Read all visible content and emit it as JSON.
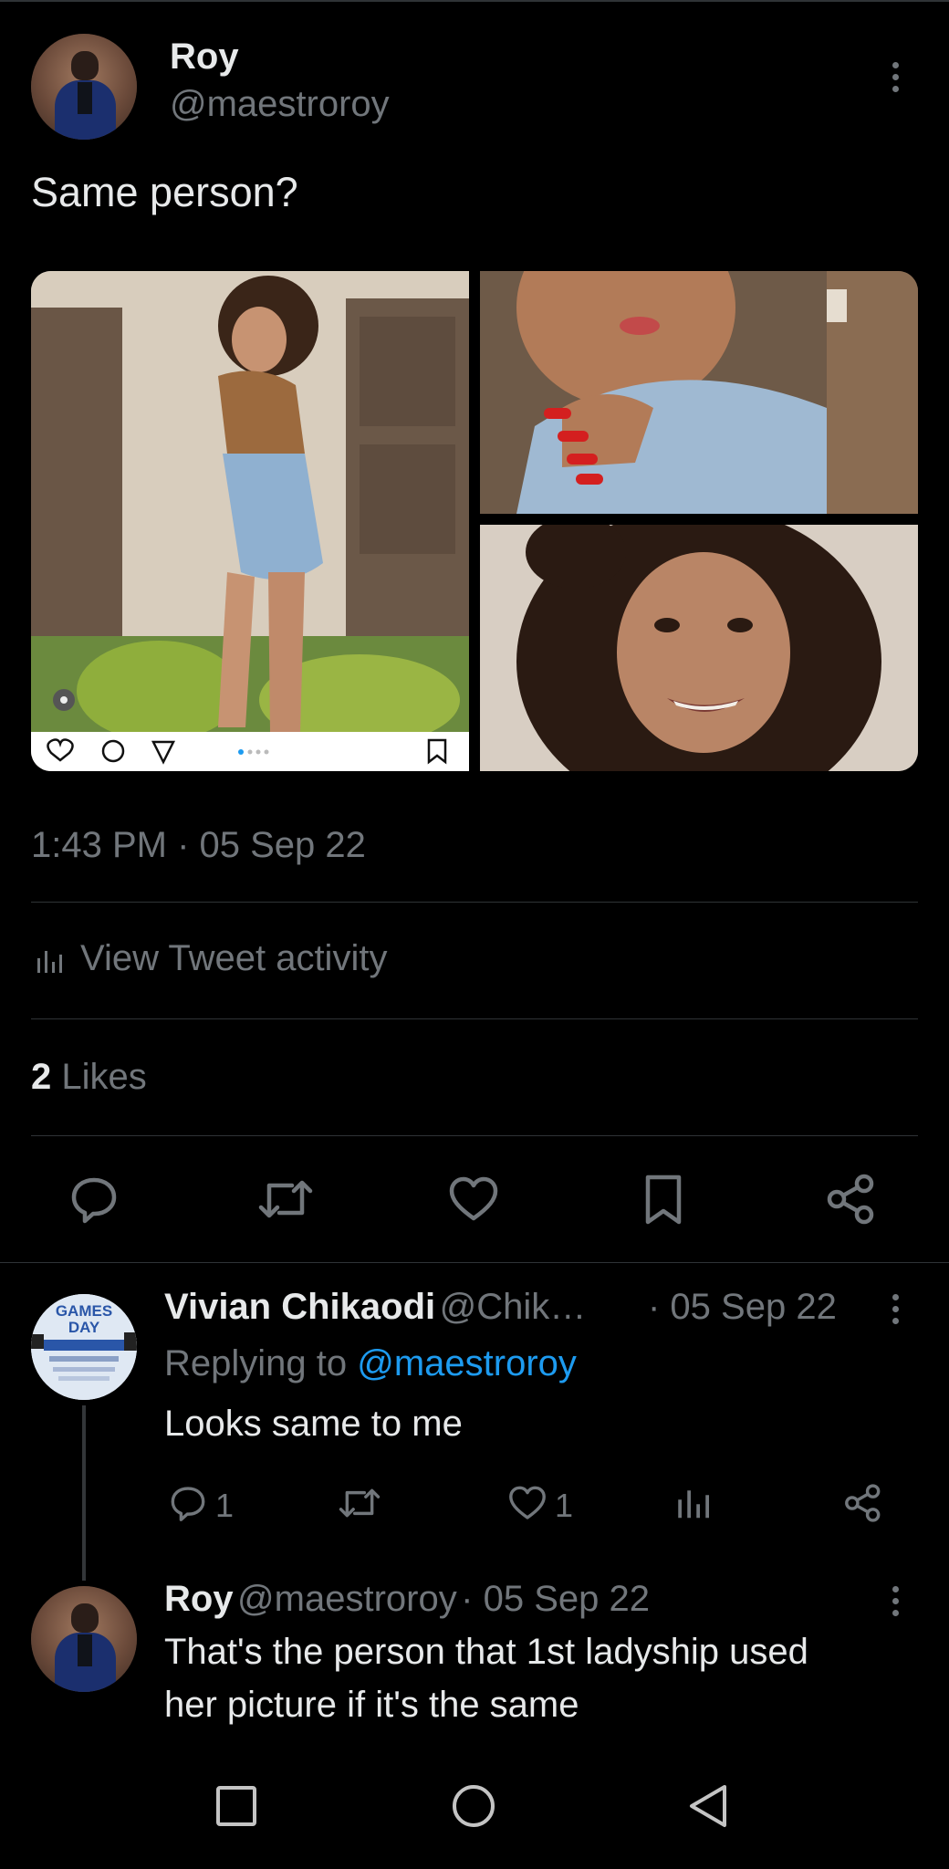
{
  "tweet": {
    "author_name": "Roy",
    "author_handle": "@maestroroy",
    "text": "Same person?",
    "timestamp": "1:43 PM · 05 Sep 22",
    "activity_label": "View Tweet activity",
    "likes_count": "2",
    "likes_label": "Likes"
  },
  "replies": [
    {
      "name": "Vivian Chikaodi",
      "handle": "@Chik…",
      "date": "· 05 Sep 22",
      "replying_prefix": "Replying to",
      "replying_to": "@maestroroy",
      "text": "Looks same to me",
      "reply_count": "1",
      "like_count": "1",
      "avatar_text": "GAMES DAY"
    },
    {
      "name": "Roy",
      "handle": "@maestroroy",
      "date": "· 05 Sep 22",
      "text_line1": "That's the person that 1st ladyship used",
      "text_line2": "her picture if it's the same"
    }
  ],
  "icons": {
    "reply": "reply-icon",
    "retweet": "retweet-icon",
    "like": "heart-icon",
    "bookmark": "bookmark-icon",
    "share": "share-icon",
    "analytics": "analytics-icon",
    "more": "more-icon"
  },
  "colors": {
    "background": "#000000",
    "text": "#e7e9ea",
    "secondary": "#71767b",
    "link": "#1d9bf0",
    "divider": "#2f3336"
  }
}
